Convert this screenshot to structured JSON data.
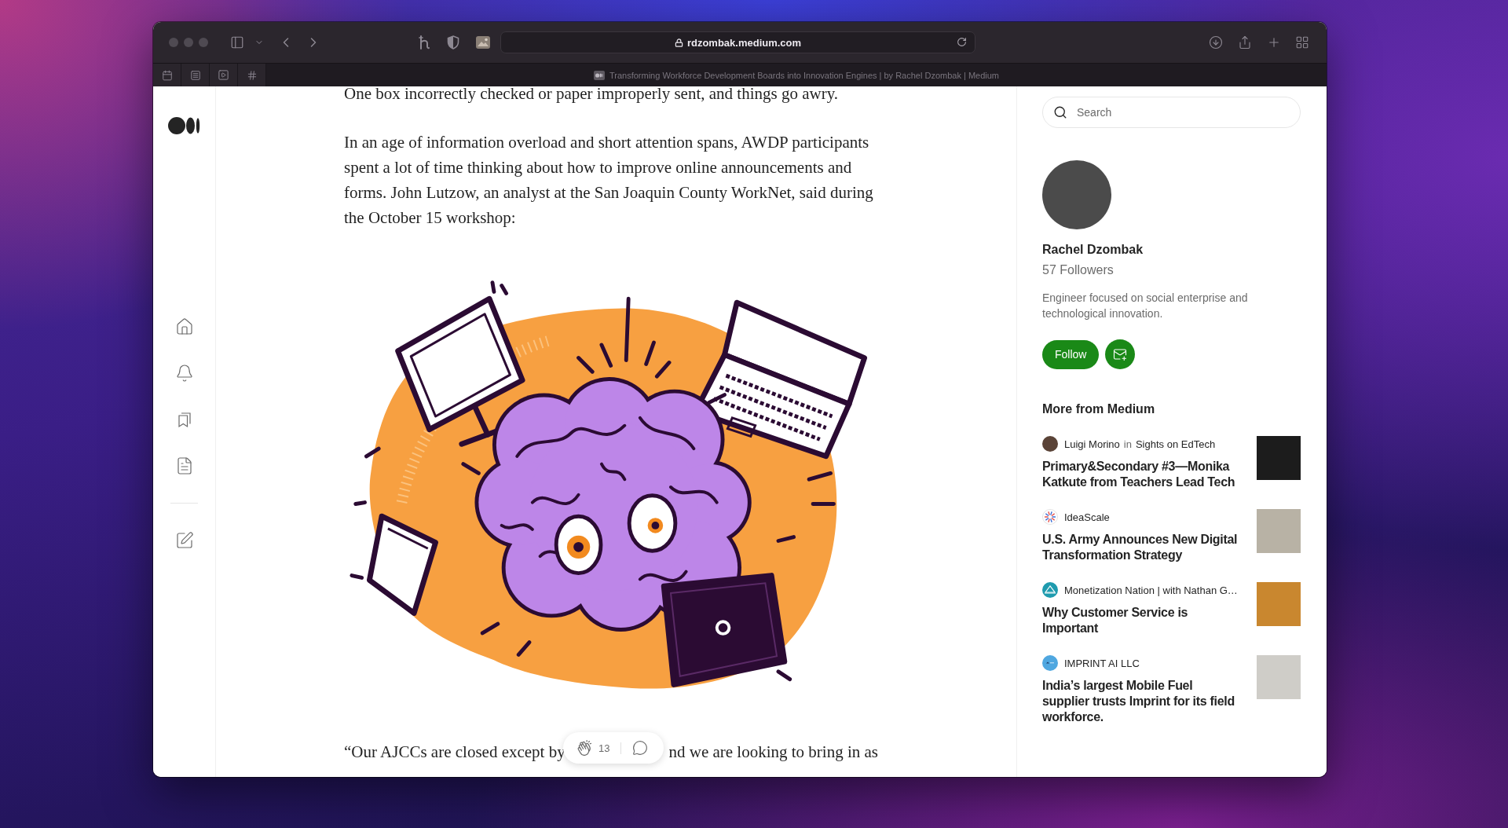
{
  "browser": {
    "address": "rdzombak.medium.com",
    "tab_title": "Transforming Workforce Development Boards into Innovation Engines | by Rachel Dzombak | Medium"
  },
  "article": {
    "paragraphs": [
      "One box incorrectly checked or paper improperly sent, and things go awry.",
      "In an age of information overload and short attention spans, AWDP participants spent a lot of time thinking about how to improve online announcements and forms. John Lutzow, an analyst at the San Joaquin County WorkNet, said during the October 15 workshop:"
    ],
    "quote_line": {
      "before": "“Our AJCCs are closed except by",
      "after": "nd we are looking to bring in as"
    }
  },
  "clap_bar": {
    "claps": "13"
  },
  "sidebar": {
    "search": {
      "placeholder": "Search"
    },
    "author": {
      "name": "Rachel Dzombak",
      "followers": "57 Followers",
      "bio": "Engineer focused on social enterprise and technological innovation.",
      "follow_label": "Follow"
    },
    "more_title": "More from Medium",
    "stories": [
      {
        "author": "Luigi Morino",
        "connector": "in",
        "publication": "Sights on EdTech",
        "title": "Primary&Secondary #3—Monika Katkute from Teachers Lead Tech"
      },
      {
        "author": "IdeaScale",
        "title": "U.S. Army Announces New Digital Transformation Strategy"
      },
      {
        "author": "Monetization Nation | with Nathan G…",
        "title": "Why Customer Service is Important"
      },
      {
        "author": "IMPRINT AI LLC",
        "title": "India’s largest Mobile Fuel supplier trusts Imprint for its field workforce."
      }
    ]
  }
}
